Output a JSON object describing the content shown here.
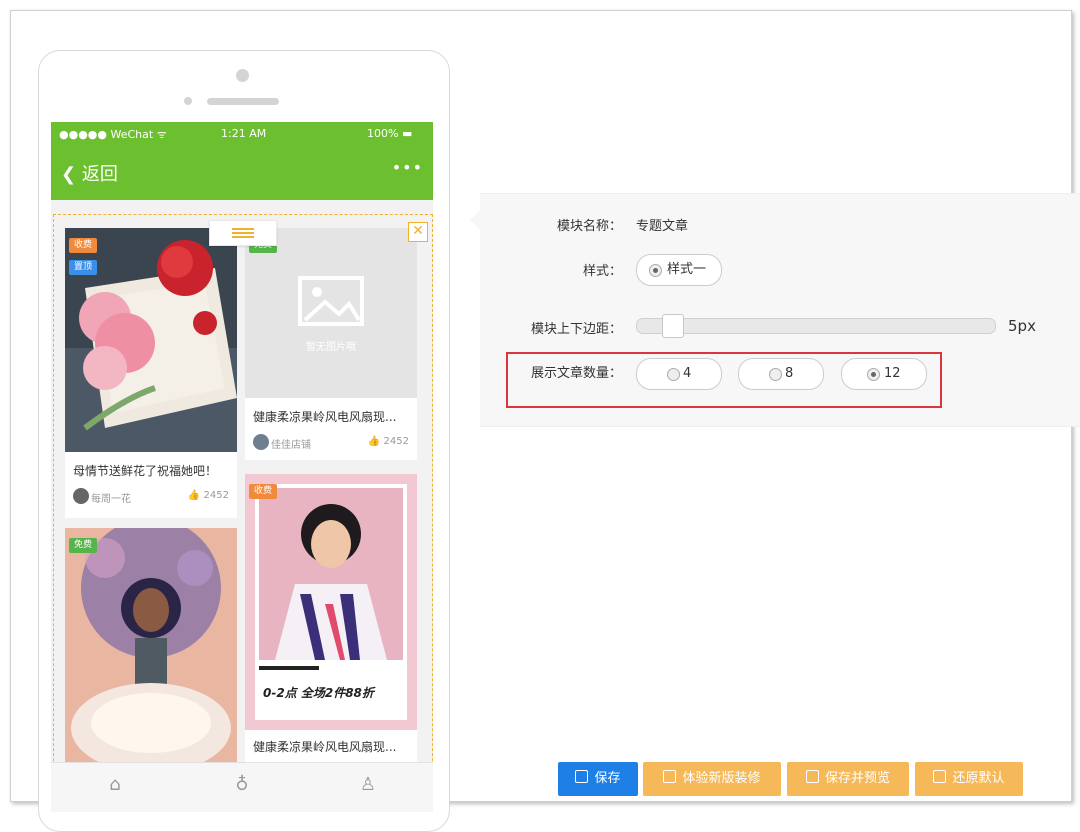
{
  "phone": {
    "status": {
      "carrier": "●●●●● WeChat ᯤ",
      "time": "1:21 AM",
      "battery": "100% ▬"
    },
    "nav": {
      "back_label": "返回",
      "more_label": "•••"
    },
    "articles": [
      {
        "badges": [
          "收费",
          "置顶"
        ],
        "title": "母情节送鲜花了祝福她吧！",
        "author": "每周一花",
        "likes": "2452"
      },
      {
        "badges": [
          "免费"
        ],
        "placeholder_text": "暂无图片哦",
        "title": "健康柔凉果岭风电风扇现...",
        "author": "佳佳店铺",
        "likes": "2452"
      },
      {
        "badges": [
          "免费"
        ]
      },
      {
        "badges": [
          "收费"
        ],
        "poster_promo": "0-2点 全场2件88折",
        "title": "健康柔凉果岭风电风扇现..."
      }
    ]
  },
  "settings": {
    "module_name_label": "模块名称：",
    "module_name_value": "专题文章",
    "style_label": "样式：",
    "style_option": "样式一",
    "margin_label": "模块上下边距：",
    "margin_value": "5px",
    "count_label": "展示文章数量：",
    "count_options": [
      "4",
      "8",
      "12"
    ],
    "count_selected": "12"
  },
  "buttons": {
    "save": "保存",
    "try_new": "体验新版装修",
    "save_preview": "保存并预览",
    "restore": "还原默认"
  },
  "colors": {
    "wechat_green": "#6cbf2e",
    "badge_paid": "#f08a3c",
    "badge_top": "#3b8fe8",
    "badge_free": "#55b54a",
    "save_button": "#1e7fe6",
    "secondary_button": "#f5b95a",
    "highlight_box": "#d9363e"
  }
}
